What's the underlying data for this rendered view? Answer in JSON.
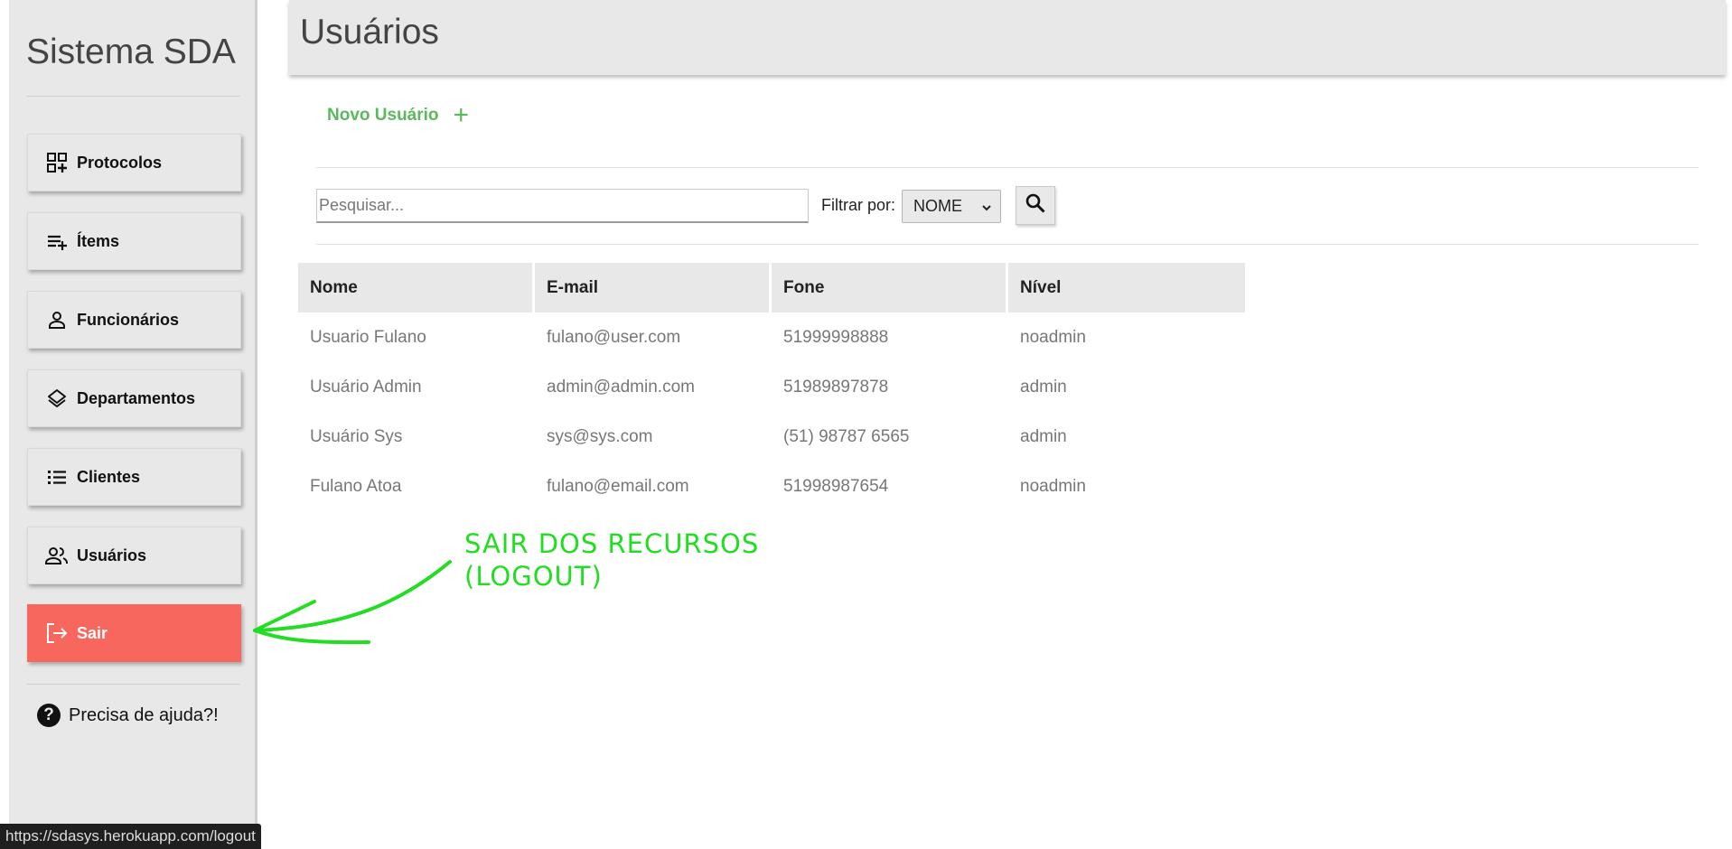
{
  "sidebar": {
    "brand": "Sistema SDA",
    "items": [
      {
        "label": "Protocolos",
        "icon": "grid-plus-icon"
      },
      {
        "label": "Ítems",
        "icon": "playlist-add-icon"
      },
      {
        "label": "Funcionários",
        "icon": "person-icon"
      },
      {
        "label": "Departamentos",
        "icon": "layers-icon"
      },
      {
        "label": "Clientes",
        "icon": "list-icon"
      },
      {
        "label": "Usuários",
        "icon": "people-icon"
      }
    ],
    "logout": {
      "label": "Sair",
      "icon": "logout-icon",
      "color": "#f7675d"
    },
    "help": {
      "label": "Precisa de ajuda?!",
      "icon": "question-icon"
    }
  },
  "header": {
    "title": "Usuários"
  },
  "actions": {
    "new_user_label": "Novo Usuário",
    "new_user_icon": "plus-icon",
    "color": "#5cb85c"
  },
  "search": {
    "placeholder": "Pesquisar...",
    "filter_label": "Filtrar por:",
    "filter_selected": "NOME",
    "button_icon": "magnifier-icon"
  },
  "table": {
    "columns": [
      "Nome",
      "E-mail",
      "Fone",
      "Nível"
    ],
    "rows": [
      [
        "Usuario Fulano",
        "fulano@user.com",
        "51999998888",
        "noadmin"
      ],
      [
        "Usuário Admin",
        "admin@admin.com",
        "51989897878",
        "admin"
      ],
      [
        "Usuário Sys",
        "sys@sys.com",
        "(51) 98787 6565",
        "admin"
      ],
      [
        "Fulano Atoa",
        "fulano@email.com",
        "51998987654",
        "noadmin"
      ]
    ]
  },
  "annotation": {
    "line1": "SAIR DOS RECURSOS",
    "line2": "(LOGOUT)",
    "color": "#22dd22"
  },
  "status_bar": {
    "url": "https://sdasys.herokuapp.com/logout"
  }
}
